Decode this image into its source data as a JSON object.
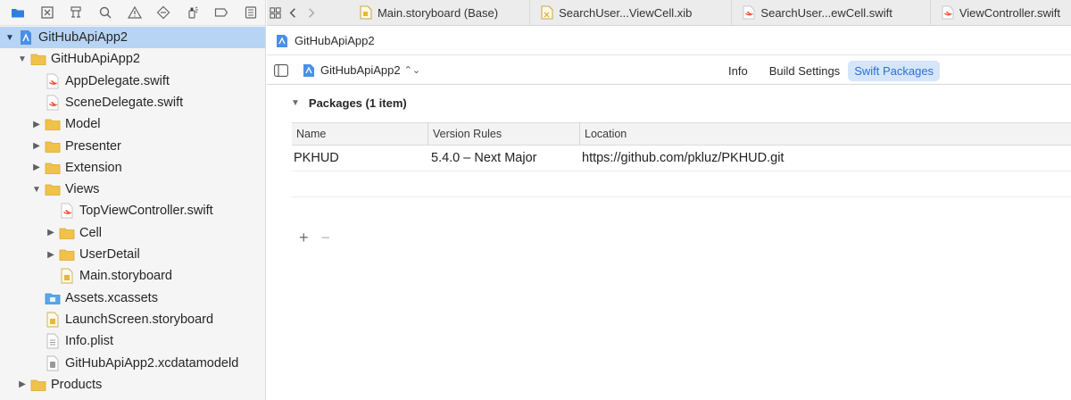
{
  "sidebar": {
    "nav_icons": [
      "folder-icon",
      "x-square-icon",
      "hierarchy-icon",
      "search-icon",
      "warning-icon",
      "diamond-icon",
      "debug-spray-icon",
      "breakpoint-icon",
      "report-icon"
    ],
    "tree": [
      {
        "label": "GitHubApiApp2",
        "depth": 0,
        "disclosure": "open",
        "icon": "project-icon",
        "selected": true
      },
      {
        "label": "GitHubApiApp2",
        "depth": 1,
        "disclosure": "open",
        "icon": "folder-icon"
      },
      {
        "label": "AppDelegate.swift",
        "depth": 2,
        "disclosure": "none",
        "icon": "swift-file-icon"
      },
      {
        "label": "SceneDelegate.swift",
        "depth": 2,
        "disclosure": "none",
        "icon": "swift-file-icon"
      },
      {
        "label": "Model",
        "depth": 2,
        "disclosure": "closed",
        "icon": "folder-icon"
      },
      {
        "label": "Presenter",
        "depth": 2,
        "disclosure": "closed",
        "icon": "folder-icon"
      },
      {
        "label": "Extension",
        "depth": 2,
        "disclosure": "closed",
        "icon": "folder-icon"
      },
      {
        "label": "Views",
        "depth": 2,
        "disclosure": "open",
        "icon": "folder-icon"
      },
      {
        "label": "TopViewController.swift",
        "depth": 3,
        "disclosure": "none",
        "icon": "swift-file-icon"
      },
      {
        "label": "Cell",
        "depth": 3,
        "disclosure": "closed",
        "icon": "folder-icon"
      },
      {
        "label": "UserDetail",
        "depth": 3,
        "disclosure": "closed",
        "icon": "folder-icon"
      },
      {
        "label": "Main.storyboard",
        "depth": 3,
        "disclosure": "none",
        "icon": "storyboard-file-icon"
      },
      {
        "label": "Assets.xcassets",
        "depth": 2,
        "disclosure": "none",
        "icon": "assets-folder-icon"
      },
      {
        "label": "LaunchScreen.storyboard",
        "depth": 2,
        "disclosure": "none",
        "icon": "storyboard-file-icon"
      },
      {
        "label": "Info.plist",
        "depth": 2,
        "disclosure": "none",
        "icon": "plist-file-icon"
      },
      {
        "label": "GitHubApiApp2.xcdatamodeld",
        "depth": 2,
        "disclosure": "none",
        "icon": "datamodel-file-icon"
      },
      {
        "label": "Products",
        "depth": 1,
        "disclosure": "closed",
        "icon": "folder-icon"
      }
    ]
  },
  "tabbar": {
    "tabs": [
      {
        "label": "Main.storyboard (Base)",
        "icon": "storyboard-file-icon"
      },
      {
        "label": "SearchUser...ViewCell.xib",
        "icon": "xib-file-icon"
      },
      {
        "label": "SearchUser...ewCell.swift",
        "icon": "swift-file-icon"
      },
      {
        "label": "ViewController.swift",
        "icon": "swift-file-icon"
      }
    ]
  },
  "breadcrumb": {
    "label": "GitHubApiApp2"
  },
  "editor": {
    "target_label": "GitHubApiApp2",
    "segments": {
      "info": "Info",
      "build_settings": "Build Settings",
      "swift_packages": "Swift Packages"
    },
    "section_title": "Packages (1 item)",
    "table": {
      "headers": {
        "name": "Name",
        "version": "Version Rules",
        "location": "Location"
      },
      "rows": [
        {
          "name": "PKHUD",
          "version": "5.4.0 – Next Major",
          "location": "https://github.com/pkluz/PKHUD.git"
        }
      ]
    },
    "add_label": "+",
    "remove_label": "−"
  },
  "colors": {
    "selection": "#b7d4f4",
    "accent": "#2c6fd8",
    "folder": "#f0c24a",
    "swift": "#f05138"
  }
}
